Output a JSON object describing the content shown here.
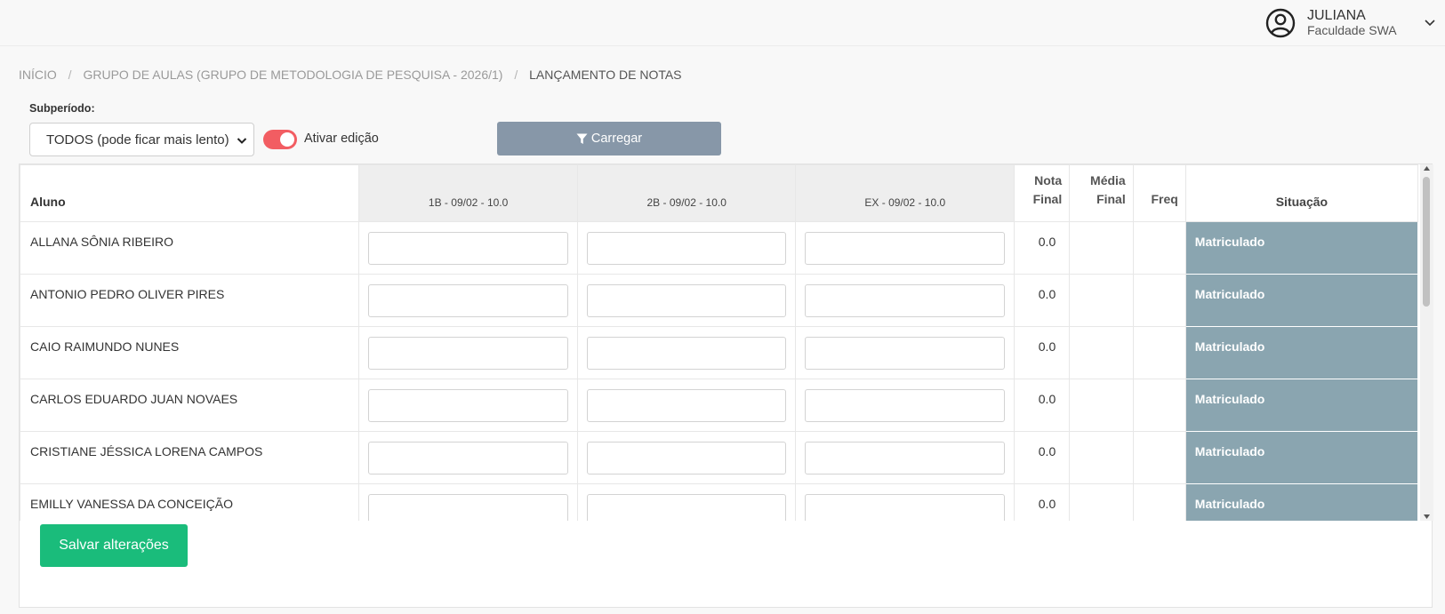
{
  "header": {
    "user_name": "JULIANA",
    "user_org": "Faculdade SWA"
  },
  "breadcrumb": {
    "items": [
      "INÍCIO",
      "GRUPO DE AULAS (GRUPO DE METODOLOGIA DE PESQUISA - 2026/1)",
      "LANÇAMENTO DE NOTAS"
    ]
  },
  "filters": {
    "subperiod_label": "Subperíodo:",
    "subperiod_value": "TODOS (pode ficar mais lento)",
    "toggle_label": "Ativar edição",
    "toggle_on": true,
    "load_label": "Carregar"
  },
  "table": {
    "columns": {
      "aluno": "Aluno",
      "g1": "1B - 09/02 - 10.0",
      "g2": "2B - 09/02 - 10.0",
      "g3": "EX - 09/02 - 10.0",
      "nota_final_1": "Nota",
      "nota_final_2": "Final",
      "media_final_1": "Média",
      "media_final_2": "Final",
      "freq": "Freq",
      "situacao": "Situação"
    },
    "rows": [
      {
        "name": "ALLANA SÔNIA RIBEIRO",
        "nota_final": "0.0",
        "situacao": "Matriculado"
      },
      {
        "name": "ANTONIO PEDRO OLIVER PIRES",
        "nota_final": "0.0",
        "situacao": "Matriculado"
      },
      {
        "name": "CAIO RAIMUNDO NUNES",
        "nota_final": "0.0",
        "situacao": "Matriculado"
      },
      {
        "name": "CARLOS EDUARDO JUAN NOVAES",
        "nota_final": "0.0",
        "situacao": "Matriculado"
      },
      {
        "name": "CRISTIANE JÉSSICA LORENA CAMPOS",
        "nota_final": "0.0",
        "situacao": "Matriculado"
      },
      {
        "name": "EMILLY VANESSA DA CONCEIÇÃO",
        "nota_final": "0.0",
        "situacao": "Matriculado"
      }
    ]
  },
  "actions": {
    "save_label": "Salvar alterações"
  },
  "colors": {
    "toggle": "#f25d62",
    "load_button": "#8797a8",
    "save_button": "#1abc7b",
    "situacao_bg": "#8aa5b0"
  },
  "icons": {
    "avatar": "user-circle-icon",
    "chevron": "chevron-down-icon",
    "filter": "filter-icon"
  }
}
